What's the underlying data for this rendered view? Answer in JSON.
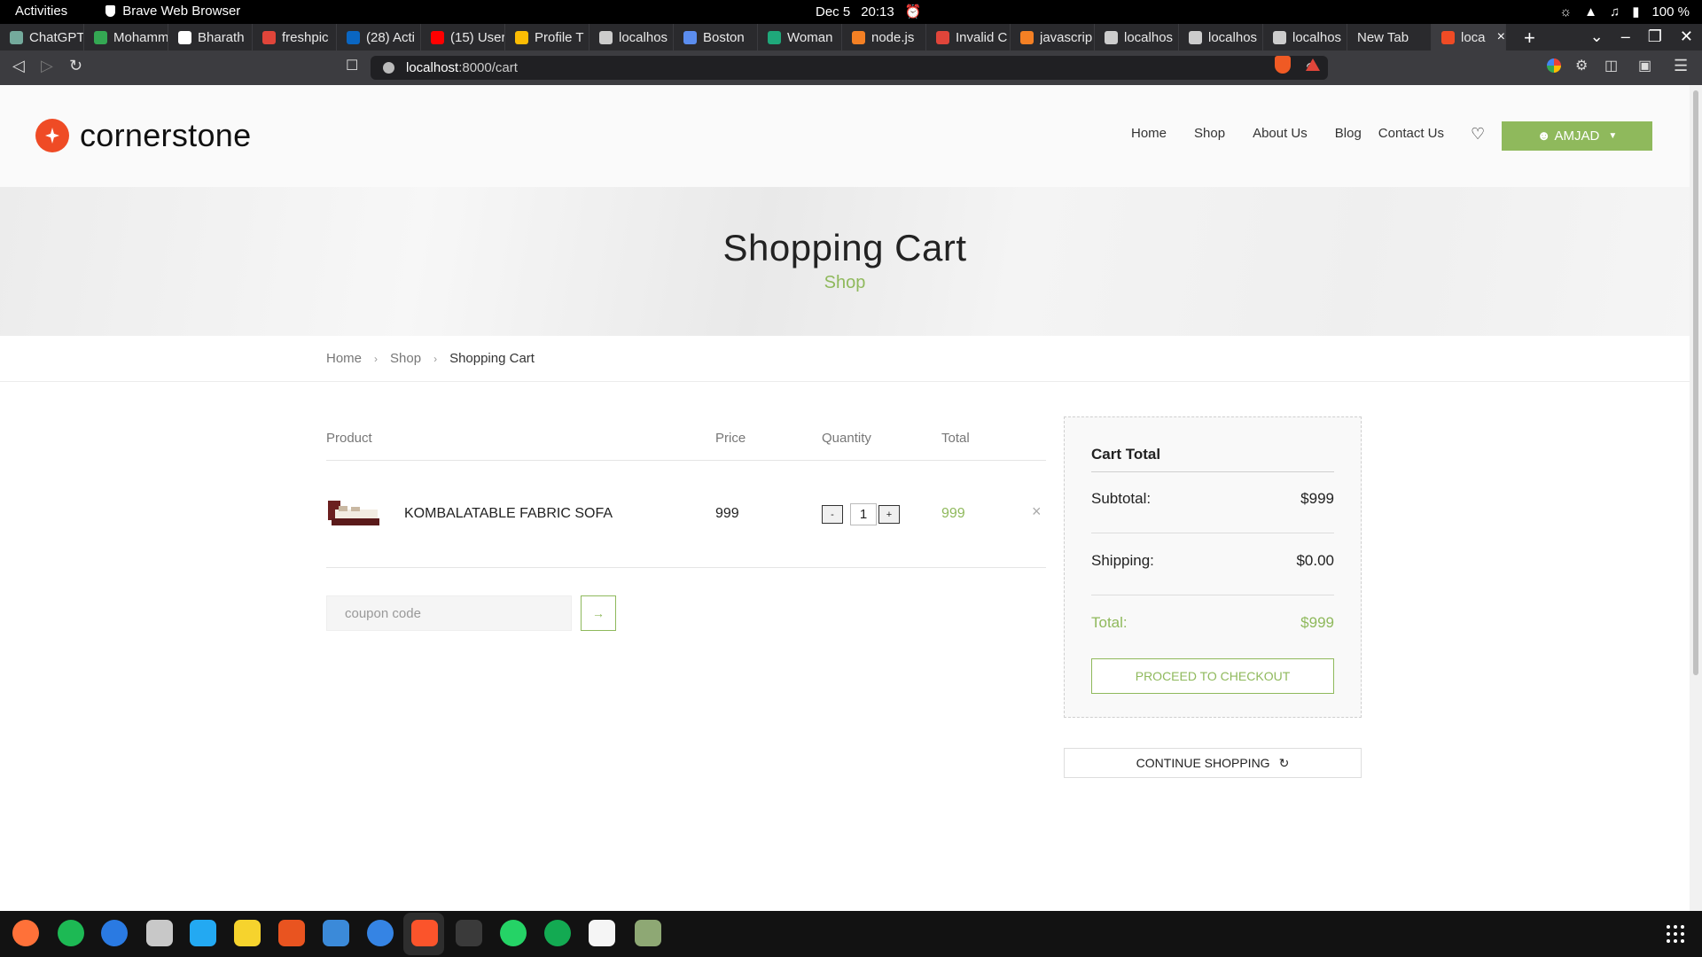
{
  "system": {
    "activities": "Activities",
    "app_name": "Brave Web Browser",
    "date": "Dec 5",
    "time": "20:13",
    "battery": "100 %"
  },
  "browser": {
    "tabs": [
      {
        "label": "ChatGPT",
        "color": "#74aa9c"
      },
      {
        "label": "Mohamm",
        "color": "#34a853"
      },
      {
        "label": "Bharath",
        "color": "#ffffff"
      },
      {
        "label": "freshpic",
        "color": "#e0453a"
      },
      {
        "label": "(28) Acti",
        "color": "#0a66c2"
      },
      {
        "label": "(15) User",
        "color": "#ff0000"
      },
      {
        "label": "Profile T",
        "color": "#fbbc04"
      },
      {
        "label": "localhos",
        "color": "#cccccc"
      },
      {
        "label": "Boston",
        "color": "#5b8def"
      },
      {
        "label": "Woman",
        "color": "#1fa87a"
      },
      {
        "label": "node.js",
        "color": "#f48024"
      },
      {
        "label": "Invalid C",
        "color": "#e0453a"
      },
      {
        "label": "javascrip",
        "color": "#f48024"
      },
      {
        "label": "localhos",
        "color": "#cccccc"
      },
      {
        "label": "localhos",
        "color": "#cccccc"
      },
      {
        "label": "localhos",
        "color": "#cccccc"
      },
      {
        "label": "New Tab",
        "color": ""
      },
      {
        "label": "local",
        "color": "#ef4b25"
      }
    ],
    "url_host": "localhost",
    "url_path": ":8000/cart"
  },
  "site": {
    "brand": "cornerstone",
    "nav": [
      "Home",
      "Shop",
      "About Us",
      "Blog",
      "Contact Us"
    ],
    "user": "AMJAD",
    "accent_color": "#8fb95c",
    "logo_color": "#ef4b25"
  },
  "hero": {
    "title": "Shopping Cart",
    "subtitle": "Shop"
  },
  "breadcrumb": [
    "Home",
    "Shop",
    "Shopping Cart"
  ],
  "cart": {
    "headers": {
      "product": "Product",
      "price": "Price",
      "quantity": "Quantity",
      "total": "Total"
    },
    "items": [
      {
        "name": "KOMBALATABLE FABRIC SOFA",
        "price": "999",
        "quantity": "1",
        "total": "999"
      }
    ],
    "qty_minus": "-",
    "qty_plus": "+",
    "remove_glyph": "×",
    "coupon_placeholder": "coupon code",
    "coupon_glyph": "→"
  },
  "summary": {
    "title": "Cart Total",
    "subtotal_label": "Subtotal:",
    "subtotal_value": "$999",
    "shipping_label": "Shipping:",
    "shipping_value": "$0.00",
    "total_label": "Total:",
    "total_value": "$999",
    "checkout_label": "PROCEED TO CHECKOUT",
    "continue_label": "CONTINUE SHOPPING"
  },
  "dock": {
    "apps": [
      {
        "name": "firefox-icon",
        "color": "#ff7139"
      },
      {
        "name": "spotify-icon",
        "color": "#1db954"
      },
      {
        "name": "thunderbird-icon",
        "color": "#2a7ae2"
      },
      {
        "name": "files-icon",
        "color": "#c8c8c8"
      },
      {
        "name": "vscode-icon",
        "color": "#23a9f2"
      },
      {
        "name": "rhythmbox-icon",
        "color": "#f6d32d"
      },
      {
        "name": "app-center-icon",
        "color": "#e95420"
      },
      {
        "name": "writer-icon",
        "color": "#3b8ad9"
      },
      {
        "name": "help-icon",
        "color": "#3584e4"
      },
      {
        "name": "brave-icon",
        "color": "#fb542b"
      },
      {
        "name": "terminal-icon",
        "color": "#3a3a3a"
      },
      {
        "name": "whatsapp-icon",
        "color": "#25d366"
      },
      {
        "name": "mongodb-icon",
        "color": "#13aa52"
      },
      {
        "name": "text-editor-icon",
        "color": "#f5f5f5"
      },
      {
        "name": "trash-icon",
        "color": "#8ea874"
      }
    ]
  }
}
